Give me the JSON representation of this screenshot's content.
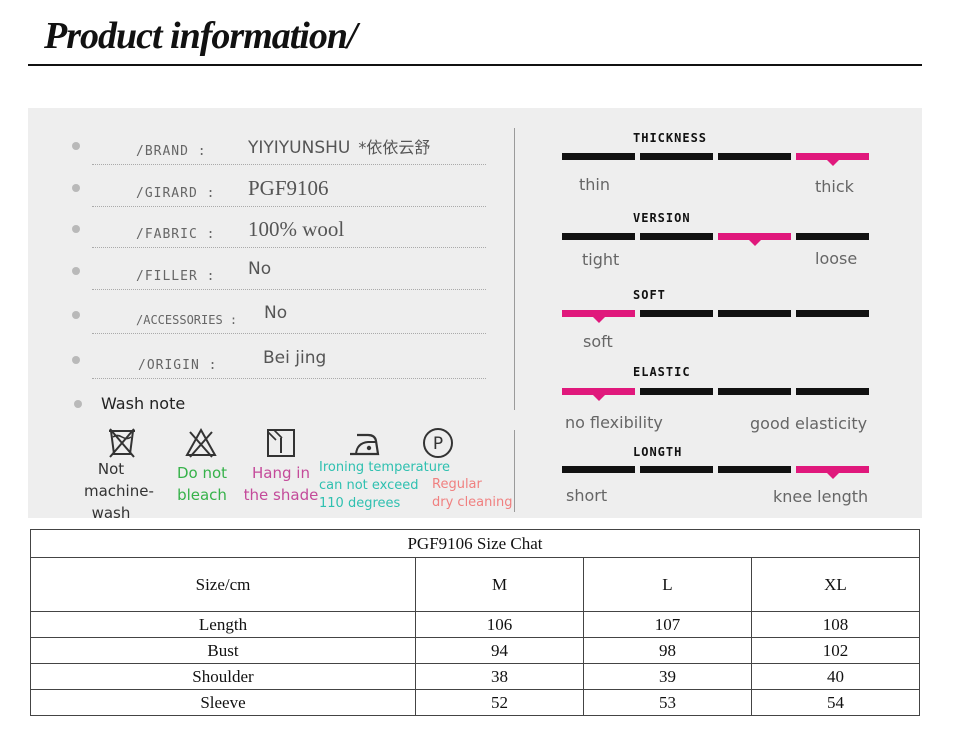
{
  "header": {
    "title": "Product information/"
  },
  "info": [
    {
      "label": "/BRAND  :",
      "value": "YIYIYUNSHU",
      "extra": "*依依云舒"
    },
    {
      "label": "/GIRARD :",
      "value": "PGF9106"
    },
    {
      "label": "/FABRIC  :",
      "value": "100% wool"
    },
    {
      "label": "/FILLER :",
      "value": "No"
    },
    {
      "label": "/ACCESSORIES :",
      "value": "No"
    },
    {
      "label": "/ORIGIN  :",
      "value": "Bei jing"
    }
  ],
  "wash": {
    "title": "Wash note",
    "items": [
      {
        "icon": "no-machine-wash-icon",
        "label": "Not\nmachine-\nwash",
        "color": "#555555"
      },
      {
        "icon": "no-bleach-icon",
        "label": "Do not\nbleach",
        "color": "#36b24a"
      },
      {
        "icon": "hang-dry-shade-icon",
        "label": "Hang in\nthe shade",
        "color": "#c44a9a"
      },
      {
        "icon": "iron-temperature-icon",
        "label": "Ironing temperature\ncan not exceed\n110 degrees",
        "color": "#2fc0b0"
      },
      {
        "icon": "dry-clean-p-icon",
        "label": "Regular\ndry cleaning",
        "color": "#f08080"
      }
    ]
  },
  "attributes": [
    {
      "title": "THICKNESS",
      "selected": 4,
      "left_label": "thin",
      "right_label": "thick"
    },
    {
      "title": "VERSION",
      "selected": 3,
      "left_label": "tight",
      "right_label": "loose"
    },
    {
      "title": "SOFT",
      "selected": 1,
      "left_label": "soft",
      "right_label": ""
    },
    {
      "title": "ELASTIC",
      "selected": 1,
      "left_label": "no flexibility",
      "right_label": "good elasticity"
    },
    {
      "title": "LONGTH",
      "selected": 4,
      "left_label": "short",
      "right_label": "knee length"
    }
  ],
  "colors": {
    "accent": "#e0187c",
    "bar": "#111111",
    "panel": "#eeeeee"
  },
  "size_chart": {
    "caption": "PGF9106  Size Chat",
    "columns": [
      "Size/cm",
      "M",
      "L",
      "XL"
    ],
    "rows": [
      [
        "Length",
        "106",
        "107",
        "108"
      ],
      [
        "Bust",
        "94",
        "98",
        "102"
      ],
      [
        "Shoulder",
        "38",
        "39",
        "40"
      ],
      [
        "Sleeve",
        "52",
        "53",
        "54"
      ]
    ]
  }
}
